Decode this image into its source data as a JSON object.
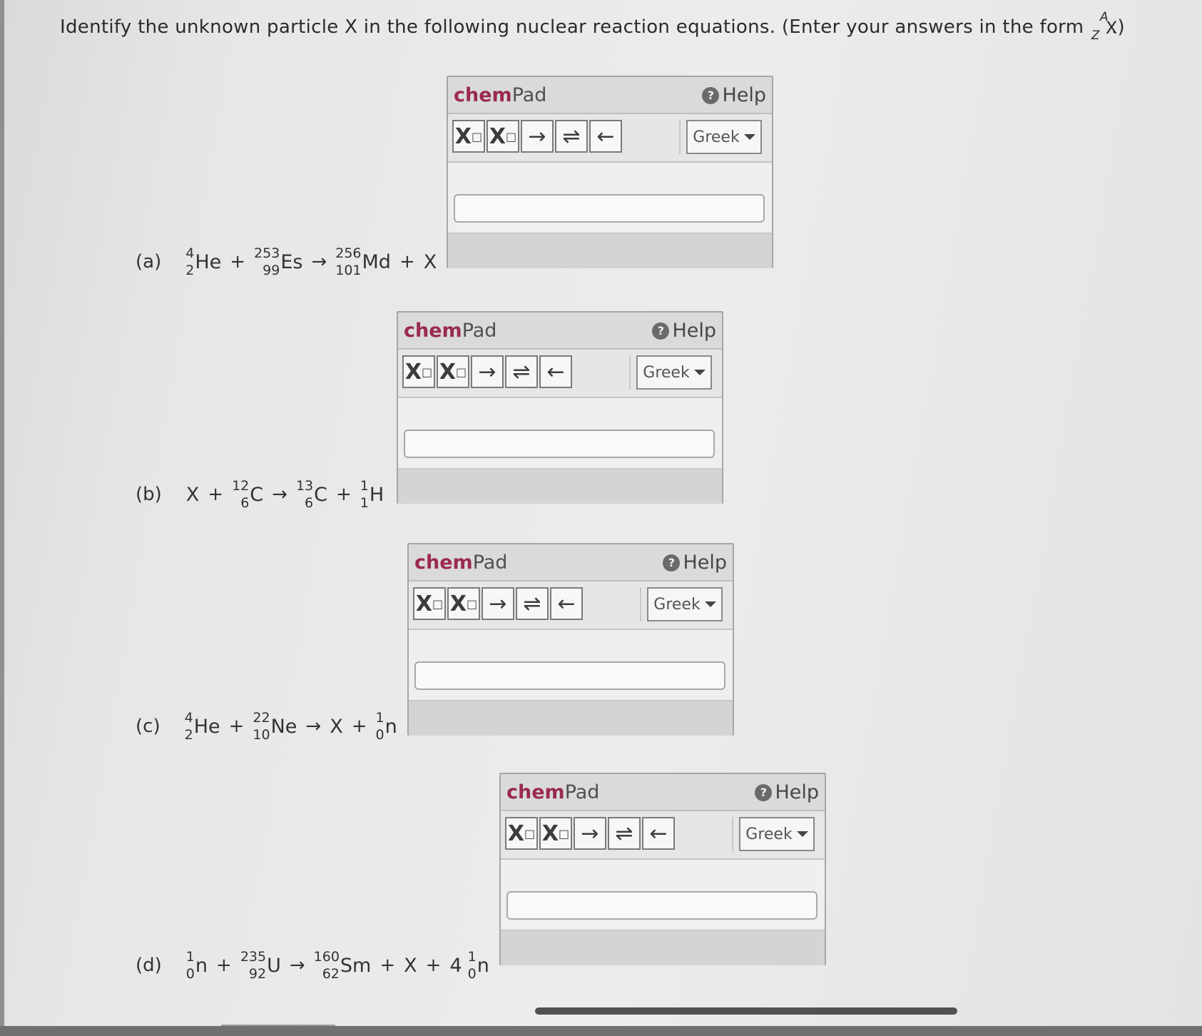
{
  "question": {
    "text": "Identify the unknown particle X in the following nuclear reaction equations. (Enter your answers in the form",
    "form_A": "A",
    "form_Z": "Z",
    "form_X": "X",
    "form_end": ".)"
  },
  "chempad": {
    "title_bold": "chem",
    "title_rest": "Pad",
    "help_label": "Help",
    "tools": [
      "X",
      "X",
      "→",
      "⇌",
      "←"
    ],
    "greek_label": "Greek",
    "answer_value": ""
  },
  "parts": [
    {
      "label": "(a)",
      "terms": [
        {
          "mass": "4",
          "atomic": "2",
          "symbol": "He"
        },
        {
          "op": "+"
        },
        {
          "mass": "253",
          "atomic": "99",
          "symbol": "Es"
        },
        {
          "op": "→"
        },
        {
          "mass": "256",
          "atomic": "101",
          "symbol": "Md"
        },
        {
          "op": "+"
        },
        {
          "symbol": "X"
        }
      ]
    },
    {
      "label": "(b)",
      "terms": [
        {
          "symbol": "X"
        },
        {
          "op": "+"
        },
        {
          "mass": "12",
          "atomic": "6",
          "symbol": "C"
        },
        {
          "op": "→"
        },
        {
          "mass": "13",
          "atomic": "6",
          "symbol": "C"
        },
        {
          "op": "+"
        },
        {
          "mass": "1",
          "atomic": "1",
          "symbol": "H"
        }
      ]
    },
    {
      "label": "(c)",
      "terms": [
        {
          "mass": "4",
          "atomic": "2",
          "symbol": "He"
        },
        {
          "op": "+"
        },
        {
          "mass": "22",
          "atomic": "10",
          "symbol": "Ne"
        },
        {
          "op": "→"
        },
        {
          "symbol": "X"
        },
        {
          "op": "+"
        },
        {
          "mass": "1",
          "atomic": "0",
          "symbol": "n"
        }
      ]
    },
    {
      "label": "(d)",
      "terms": [
        {
          "mass": "1",
          "atomic": "0",
          "symbol": "n"
        },
        {
          "op": "+"
        },
        {
          "mass": "235",
          "atomic": "92",
          "symbol": "U"
        },
        {
          "op": "→"
        },
        {
          "mass": "160",
          "atomic": "62",
          "symbol": "Sm"
        },
        {
          "op": "+"
        },
        {
          "symbol": "X"
        },
        {
          "op": "+"
        },
        {
          "coef": "4",
          "mass": "1",
          "atomic": "0",
          "symbol": "n"
        }
      ]
    }
  ]
}
